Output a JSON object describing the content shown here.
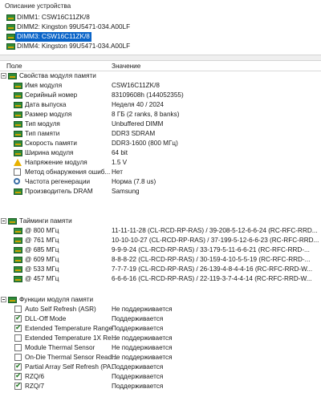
{
  "device_desc": {
    "header": "Описание устройства",
    "items": [
      "DIMM1: CSW16C11ZK/8",
      "DIMM2: Kingston 99U5471-034.A00LF",
      "DIMM3: CSW16C11ZK/8",
      "DIMM4: Kingston 99U5471-034.A00LF"
    ],
    "selected_index": 2
  },
  "columns": {
    "field": "Поле",
    "value": "Значение"
  },
  "properties": {
    "group": "Свойства модуля памяти",
    "rows": [
      {
        "name": "Имя модуля",
        "value": "CSW16C11ZK/8",
        "icon": "memory-module-icon"
      },
      {
        "name": "Серийный номер",
        "value": "83109608h (144052355)",
        "icon": "memory-module-icon"
      },
      {
        "name": "Дата выпуска",
        "value": "Неделя 40 / 2024",
        "icon": "memory-module-icon"
      },
      {
        "name": "Размер модуля",
        "value": "8 ГБ (2 ranks, 8 banks)",
        "icon": "memory-module-icon"
      },
      {
        "name": "Тип модуля",
        "value": "Unbuffered DIMM",
        "icon": "memory-module-icon"
      },
      {
        "name": "Тип памяти",
        "value": "DDR3 SDRAM",
        "icon": "memory-module-icon"
      },
      {
        "name": "Скорость памяти",
        "value": "DDR3-1600 (800 МГц)",
        "icon": "memory-module-icon"
      },
      {
        "name": "Ширина модуля",
        "value": "64 bit",
        "icon": "memory-module-icon"
      },
      {
        "name": "Напряжение модуля",
        "value": "1.5 V",
        "icon": "warning-icon"
      },
      {
        "name": "Метод обнаружения ошиб...",
        "value": "Нет",
        "icon": "box-icon"
      },
      {
        "name": "Частота регенерации",
        "value": "Норма (7.8 us)",
        "icon": "magnifier-icon"
      },
      {
        "name": "Производитель DRAM",
        "value": "Samsung",
        "icon": "memory-module-icon"
      }
    ]
  },
  "timings": {
    "group": "Тайминги памяти",
    "rows": [
      {
        "name": "@ 800 МГц",
        "value": "11-11-11-28  (CL-RCD-RP-RAS) / 39-208-5-12-6-6-24  (RC-RFC-RRD..."
      },
      {
        "name": "@ 761 МГц",
        "value": "10-10-10-27  (CL-RCD-RP-RAS) / 37-199-5-12-6-6-23  (RC-RFC-RRD..."
      },
      {
        "name": "@ 685 МГц",
        "value": "9-9-9-24  (CL-RCD-RP-RAS) / 33-179-5-11-6-6-21  (RC-RFC-RRD-..."
      },
      {
        "name": "@ 609 МГц",
        "value": "8-8-8-22  (CL-RCD-RP-RAS) / 30-159-4-10-5-5-19  (RC-RFC-RRD-..."
      },
      {
        "name": "@ 533 МГц",
        "value": "7-7-7-19  (CL-RCD-RP-RAS) / 26-139-4-8-4-4-16  (RC-RFC-RRD-W..."
      },
      {
        "name": "@ 457 МГц",
        "value": "6-6-6-16  (CL-RCD-RP-RAS) / 22-119-3-7-4-4-14  (RC-RFC-RRD-W..."
      }
    ]
  },
  "functions": {
    "group": "Функции модуля памяти",
    "rows": [
      {
        "name": "Auto Self Refresh (ASR)",
        "value": "Не поддерживается",
        "checked": false
      },
      {
        "name": "DLL-Off Mode",
        "value": "Поддерживается",
        "checked": true
      },
      {
        "name": "Extended Temperature Range",
        "value": "Поддерживается",
        "checked": true
      },
      {
        "name": "Extended Temperature 1X Re...",
        "value": "Не поддерживается",
        "checked": false
      },
      {
        "name": "Module Thermal Sensor",
        "value": "Не поддерживается",
        "checked": false
      },
      {
        "name": "On-Die Thermal Sensor Read...",
        "value": "Не поддерживается",
        "checked": false
      },
      {
        "name": "Partial Array Self Refresh (PA...",
        "value": "Поддерживается",
        "checked": true
      },
      {
        "name": "RZQ/6",
        "value": "Поддерживается",
        "checked": true
      },
      {
        "name": "RZQ/7",
        "value": "Поддерживается",
        "checked": true
      }
    ]
  },
  "colors": {
    "selection": "#0a64c8",
    "ram_green": "#2e8b3a",
    "check_green": "#1f7a1f"
  }
}
